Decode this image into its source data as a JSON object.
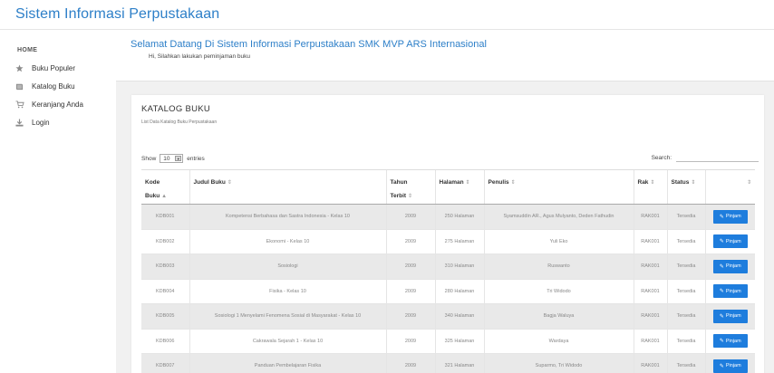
{
  "app": {
    "title": "Sistem Informasi Perpustakaan"
  },
  "sidebar": {
    "heading": "HOME",
    "items": [
      {
        "label": "Buku Populer",
        "icon": "star-icon"
      },
      {
        "label": "Katalog Buku",
        "icon": "book-icon"
      },
      {
        "label": "Keranjang Anda",
        "icon": "cart-icon"
      },
      {
        "label": "Login",
        "icon": "download-icon"
      }
    ]
  },
  "welcome": {
    "title": "Selamat Datang Di Sistem Informasi Perpustakaan SMK MVP ARS Internasional",
    "subtitle": "Hi, Silahkan lakukan peminjaman buku"
  },
  "catalog": {
    "title": "KATALOG BUKU",
    "subtitle": "List Data Katalog Buku Perpustakaan",
    "show_prefix": "Show",
    "show_value": "10",
    "show_suffix": "entries",
    "search_label": "Search:",
    "search_value": "",
    "headers": {
      "kode_a": "Kode",
      "kode_b": "Buku",
      "judul": "Judul Buku",
      "tahun_a": "Tahun",
      "tahun_b": "Terbit",
      "halaman": "Halaman",
      "penulis": "Penulis",
      "rak": "Rak",
      "status": "Status"
    },
    "button_label": "Pinjam",
    "rows": [
      {
        "kode": "KDB001",
        "judul": "Kompetensi Berbahasa dan Sastra Indonesia - Kelas 10",
        "tahun": "2009",
        "halaman": "250 Halaman",
        "penulis": "Syamsuddin AR., Agus Mulyanto, Deden Fathudin",
        "rak": "RAK001",
        "status": "Tersedia"
      },
      {
        "kode": "KDB002",
        "judul": "Ekonomi - Kelas 10",
        "tahun": "2009",
        "halaman": "275 Halaman",
        "penulis": "Yuli Eko",
        "rak": "RAK001",
        "status": "Tersedia"
      },
      {
        "kode": "KDB003",
        "judul": "Sosiologi",
        "tahun": "2009",
        "halaman": "310 Halaman",
        "penulis": "Ruswanto",
        "rak": "RAK001",
        "status": "Tersedia"
      },
      {
        "kode": "KDB004",
        "judul": "Fisika - Kelas 10",
        "tahun": "2009",
        "halaman": "280 Halaman",
        "penulis": "Tri Widodo",
        "rak": "RAK001",
        "status": "Tersedia"
      },
      {
        "kode": "KDB005",
        "judul": "Sosiologi 1 Menyelami Fenomena Sosial di Masyarakat - Kelas 10",
        "tahun": "2009",
        "halaman": "340 Halaman",
        "penulis": "Bagja Waluya",
        "rak": "RAK001",
        "status": "Tersedia"
      },
      {
        "kode": "KDB006",
        "judul": "Cakrawala Sejarah 1 - Kelas 10",
        "tahun": "2009",
        "halaman": "325 Halaman",
        "penulis": "Wardaya",
        "rak": "RAK001",
        "status": "Tersedia"
      },
      {
        "kode": "KDB007",
        "judul": "Panduan Pembelajaran Fisika",
        "tahun": "2009",
        "halaman": "321 Halaman",
        "penulis": "Suparmo, Tri Widodo",
        "rak": "RAK001",
        "status": "Tersedia"
      }
    ]
  },
  "colors": {
    "brand": "#2d7fc8",
    "button": "#1e7ddd",
    "stripe": "#e9e9e9"
  }
}
